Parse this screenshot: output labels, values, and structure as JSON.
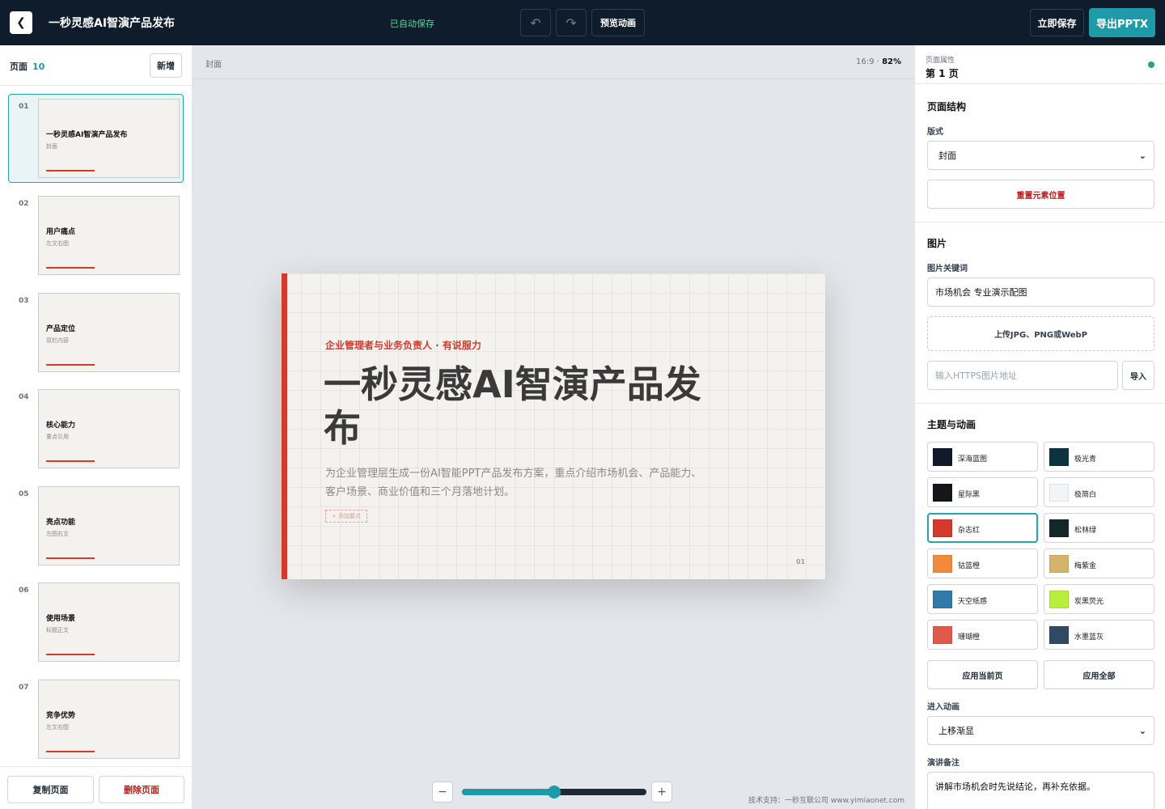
{
  "topbar": {
    "title": "一秒灵感AI智演产品发布",
    "autosave_status": "已自动保存",
    "preview_label": "预览动画",
    "save_label": "立即保存",
    "export_label": "导出PPTX",
    "undo_icon": "undo-icon",
    "redo_icon": "redo-icon",
    "back_icon": "chevron-left-icon"
  },
  "sidebar": {
    "title": "页面",
    "count": "10",
    "add_label": "新增",
    "pages": [
      {
        "num": "01",
        "title": "一秒灵感AI智演产品发布",
        "layout": "封面",
        "active": true
      },
      {
        "num": "02",
        "title": "用户痛点",
        "layout": "左文右图",
        "active": false
      },
      {
        "num": "03",
        "title": "产品定位",
        "layout": "双栏内容",
        "active": false
      },
      {
        "num": "04",
        "title": "核心能力",
        "layout": "重点引用",
        "active": false
      },
      {
        "num": "05",
        "title": "亮点功能",
        "layout": "左图右文",
        "active": false
      },
      {
        "num": "06",
        "title": "使用场景",
        "layout": "标题正文",
        "active": false
      },
      {
        "num": "07",
        "title": "竞争优势",
        "layout": "左文右图",
        "active": false
      }
    ],
    "copy_label": "复制页面",
    "delete_label": "删除页面"
  },
  "canvas": {
    "label": "封面",
    "ratio": "16:9 ·",
    "zoom": "82%",
    "zoom_value": 0.5,
    "credit": "技术支持：一秒互联公司 www.yimiaonet.com",
    "slide": {
      "kicker": "企业管理者与业务负责人 · 有说服力",
      "title": "一秒灵感AI智演产品发布",
      "body": "为企业管理层生成一份AI智能PPT产品发布方案，重点介绍市场机会、产品能力、客户场景、商业价值和三个月落地计划。",
      "add_point": "+ 添加要点",
      "page_num": "01",
      "accent_color": "#d33a2c"
    }
  },
  "panel": {
    "sub": "页面属性",
    "page": "第 1 页",
    "structure_title": "页面结构",
    "layout_label": "版式",
    "layout_value": "封面",
    "reset_label": "重置元素位置",
    "image_title": "图片",
    "keyword_label": "图片关键词",
    "keyword_value": "市场机会 专业演示配图",
    "upload_label": "上传JPG、PNG或WebP",
    "url_placeholder": "输入HTTPS图片地址",
    "import_label": "导入",
    "theme_title": "主题与动画",
    "themes": [
      {
        "name": "深海蓝图",
        "color": "#111a2b"
      },
      {
        "name": "极光青",
        "color": "#0c3340"
      },
      {
        "name": "星际黑",
        "color": "#14161a"
      },
      {
        "name": "极简白",
        "color": "#f2f5f7"
      },
      {
        "name": "杂志红",
        "color": "#d33a2c",
        "selected": true
      },
      {
        "name": "松林绿",
        "color": "#13262a"
      },
      {
        "name": "钴蓝橙",
        "color": "#f28a3c"
      },
      {
        "name": "梅紫金",
        "color": "#d4b36a"
      },
      {
        "name": "天空纸感",
        "color": "#2f7aa8"
      },
      {
        "name": "炭黑荧光",
        "color": "#b7ef3a"
      },
      {
        "name": "珊瑚橙",
        "color": "#e05a4c"
      },
      {
        "name": "水墨蓝灰",
        "color": "#2f4a63"
      }
    ],
    "apply_current_label": "应用当前页",
    "apply_all_label": "应用全部",
    "animation_label": "进入动画",
    "animation_value": "上移渐显",
    "notes_label": "演讲备注",
    "notes_value": "讲解市场机会时先说结论，再补充依据。"
  }
}
